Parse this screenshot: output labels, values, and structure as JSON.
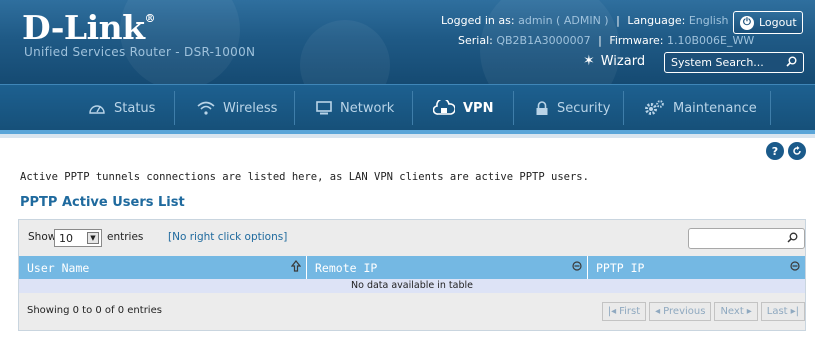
{
  "header": {
    "logo": "D-Link",
    "product": "Unified Services Router - DSR-1000N",
    "logged_in_label": "Logged in as:",
    "logged_in_value": "admin ( ADMIN )",
    "language_label": "Language:",
    "language_value": "English [US]",
    "serial_label": "Serial:",
    "serial_value": "QB2B1A3000007",
    "firmware_label": "Firmware:",
    "firmware_value": "1.10B006E_WW",
    "logout_label": "Logout",
    "wizard_label": "Wizard",
    "search_placeholder": "System Search..."
  },
  "nav": {
    "items": [
      {
        "label": "Status",
        "icon": "gauge-icon"
      },
      {
        "label": "Wireless",
        "icon": "wifi-icon"
      },
      {
        "label": "Network",
        "icon": "monitor-icon"
      },
      {
        "label": "VPN",
        "icon": "vpn-icon"
      },
      {
        "label": "Security",
        "icon": "lock-icon"
      },
      {
        "label": "Maintenance",
        "icon": "gears-icon"
      }
    ],
    "active": "VPN"
  },
  "content": {
    "description": "Active PPTP tunnels connections are listed here, as LAN VPN clients are active PPTP users.",
    "section_title": "PPTP Active Users List",
    "show_label": "Show",
    "page_length": "10",
    "entries_label": "entries",
    "no_right_click": "[No right click options]",
    "columns": [
      "User Name",
      "Remote IP",
      "PPTP IP"
    ],
    "empty_message": "No data available in table",
    "showing_info": "Showing 0 to 0 of 0 entries",
    "pager": {
      "first": "First",
      "previous": "Previous",
      "next": "Next",
      "last": "Last"
    }
  },
  "colors": {
    "header_blue": "#1f5a86",
    "accent_blue": "#5aa5d8",
    "table_header": "#74b8e3",
    "title_blue": "#1f6a9e"
  }
}
